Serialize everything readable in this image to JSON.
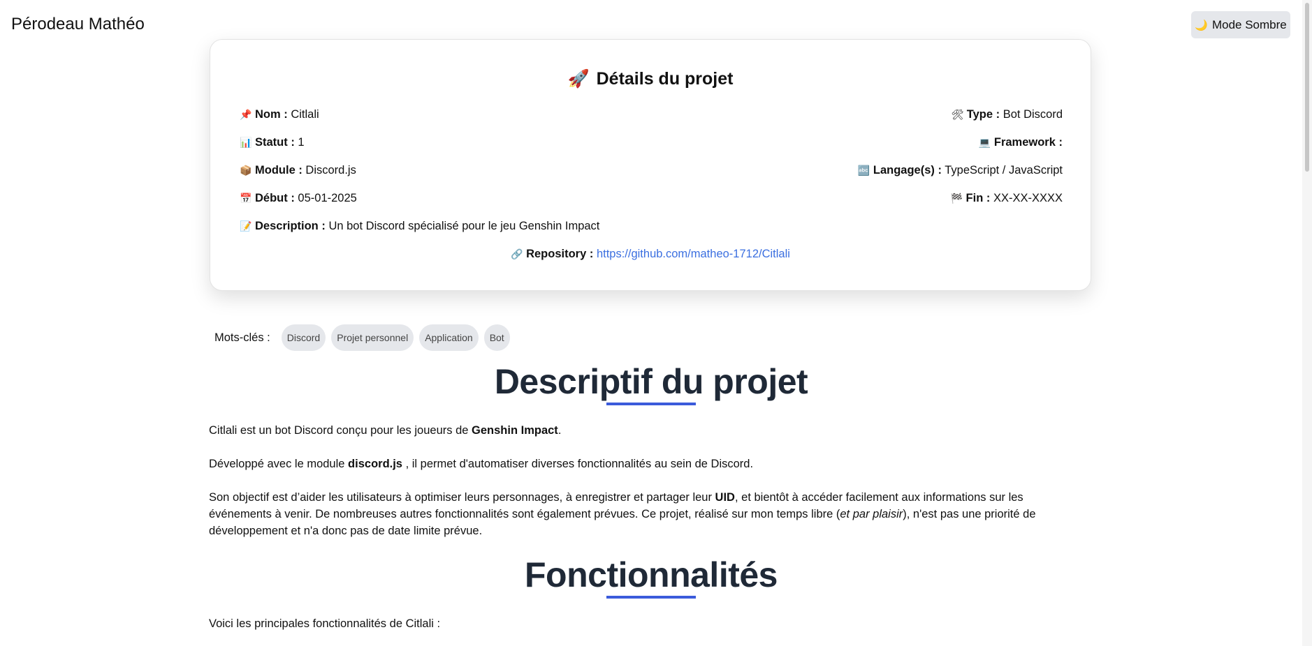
{
  "header": {
    "site_title": "Pérodeau Mathéo",
    "theme_button": {
      "icon": "moon-icon",
      "glyph": "🌙",
      "label": "Mode Sombre"
    }
  },
  "project_card": {
    "title_icon": "🚀",
    "title": "Détails du projet",
    "nom": {
      "icon": "📌",
      "label": "Nom :",
      "value": "Citlali"
    },
    "statut": {
      "icon": "📊",
      "label": "Statut :",
      "value": "1"
    },
    "module": {
      "icon": "📦",
      "label": "Module :",
      "value": "Discord.js"
    },
    "debut": {
      "icon": "📅",
      "label": "Début :",
      "value": "05-01-2025"
    },
    "description": {
      "icon": "📝",
      "label": "Description :",
      "value": "Un bot Discord spécialisé pour le jeu Genshin Impact"
    },
    "type": {
      "icon": "🛠",
      "label": "Type :",
      "value": "Bot Discord"
    },
    "framework": {
      "icon": "💻",
      "label": "Framework :",
      "value": ""
    },
    "langages": {
      "icon": "🔤",
      "label": "Langage(s) :",
      "value": "TypeScript / JavaScript"
    },
    "fin": {
      "icon": "🏁",
      "label": "Fin :",
      "value": "XX-XX-XXXX"
    },
    "repository": {
      "icon": "🔗",
      "label": "Repository :",
      "value": "https://github.com/matheo-1712/Citlali"
    }
  },
  "keywords": {
    "label": "Mots-clés :",
    "tags": [
      "Discord",
      "Projet personnel",
      "Application",
      "Bot"
    ]
  },
  "descriptif": {
    "title": "Descriptif du projet",
    "p1_text": "Citlali est un bot Discord conçu pour les joueurs de ",
    "p1_bold": "Genshin Impact",
    "p1_end": ".",
    "p2_text": "Développé avec le module ",
    "p2_bold": "discord.js",
    "p2_end": " , il permet d'automatiser diverses fonctionnalités au sein de Discord.",
    "p3_text": "Son objectif est d’aider les utilisateurs à optimiser leurs personnages, à enregistrer et partager leur ",
    "p3_bold": "UID",
    "p3_mid": ", et bientôt à accéder facilement aux informations sur les événements à venir. De nombreuses autres fonctionnalités sont également prévues. Ce projet, réalisé sur mon temps libre (",
    "p3_italic": "et par plaisir",
    "p3_end": "), n'est pas une priorité de développement et n'a donc pas de date limite prévue."
  },
  "fonctionnalites": {
    "title": "Fonctionnalités",
    "intro": "Voici les principales fonctionnalités de Citlali :"
  },
  "colors": {
    "accent_underline": "#3b5bdb",
    "link": "#3b6fe0",
    "heading": "#1f2937",
    "chip_bg": "#e5e7eb"
  }
}
